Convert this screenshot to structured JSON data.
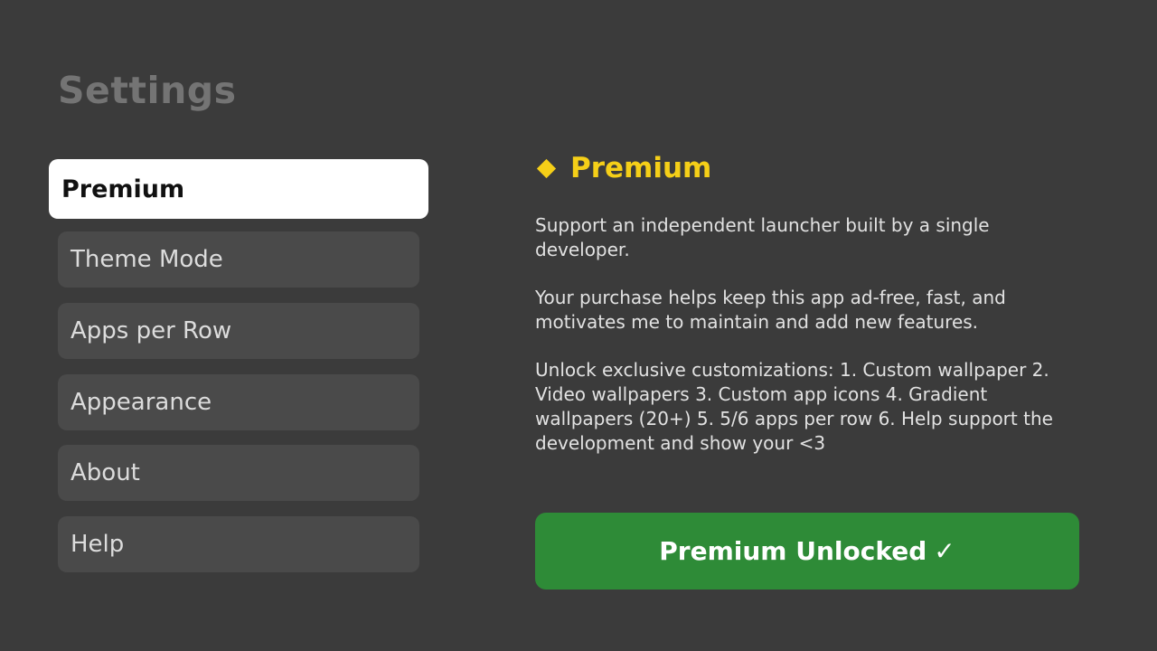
{
  "page": {
    "title": "Settings"
  },
  "menu": {
    "items": [
      {
        "label": "Premium",
        "active": true
      },
      {
        "label": "Theme Mode",
        "active": false
      },
      {
        "label": "Apps per Row",
        "active": false
      },
      {
        "label": "Appearance",
        "active": false
      },
      {
        "label": "About",
        "active": false
      },
      {
        "label": "Help",
        "active": false
      }
    ]
  },
  "panel": {
    "icon": "diamond-icon",
    "title": "Premium",
    "paragraphs": [
      "Support an independent launcher built by a single developer.",
      "Your purchase helps keep this app ad-free, fast, and motivates me to maintain and add new features.",
      "Unlock exclusive customizations: 1. Custom wallpaper 2. Video wallpapers 3. Custom app icons 4. Gradient wallpapers (20+) 5. 5/6 apps per row 6. Help support the development and show your <3"
    ],
    "button_label": "Premium Unlocked",
    "button_icon": "✓"
  },
  "colors": {
    "background": "#3b3b3b",
    "accent": "#f5cf18",
    "success": "#2e8b37",
    "menu_item": "#4a4a4a",
    "menu_active": "#ffffff"
  }
}
